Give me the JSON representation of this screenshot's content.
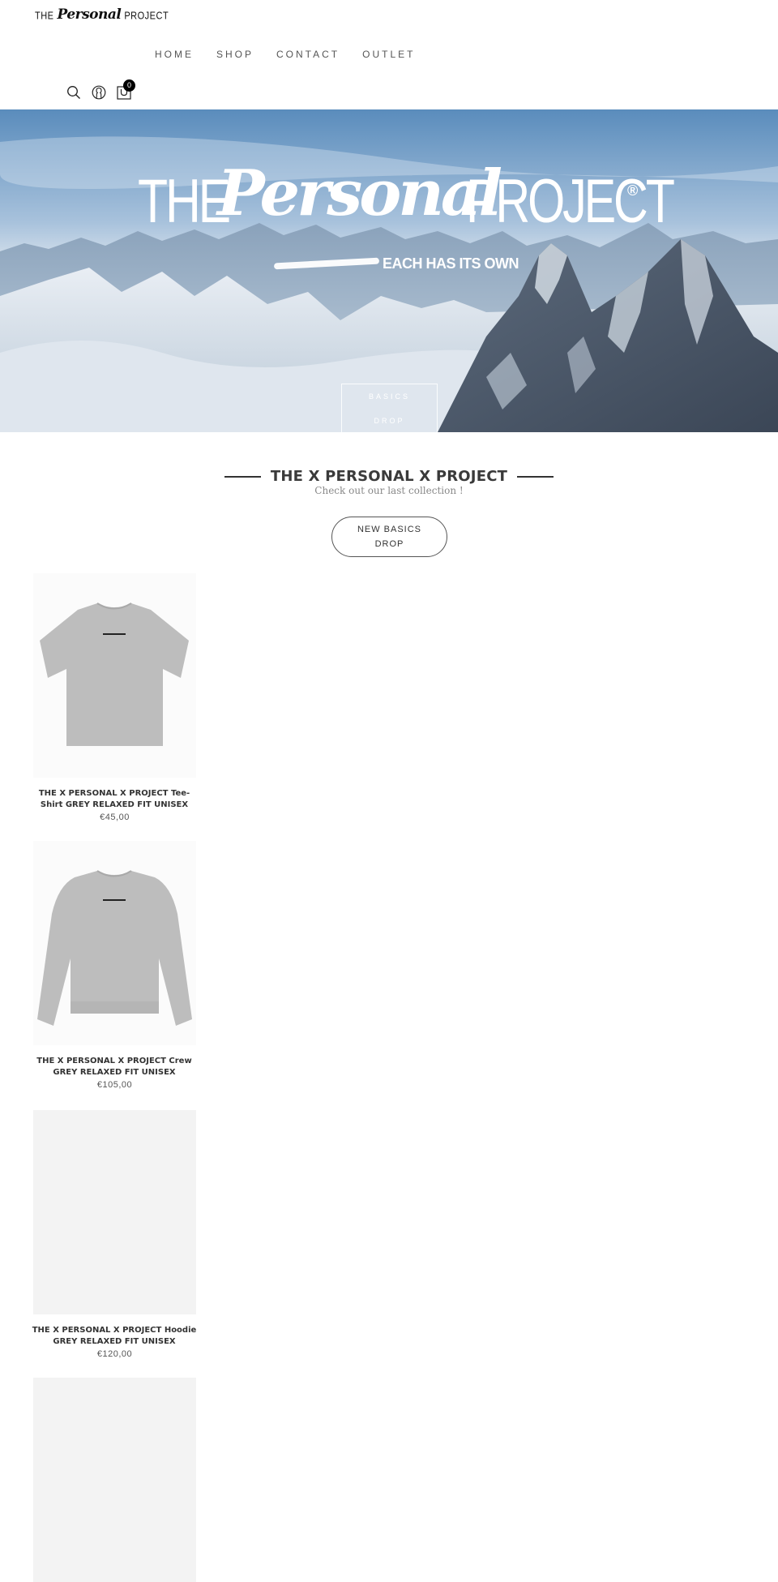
{
  "header": {
    "logo": {
      "the": "THE",
      "personal": "Personal",
      "project": "PROJECT"
    },
    "nav": [
      {
        "label": "HOME"
      },
      {
        "label": "SHOP"
      },
      {
        "label": "CONTACT"
      },
      {
        "label": "OUTLET"
      }
    ],
    "icons": [
      "search-icon",
      "account-icon",
      "cart-icon"
    ],
    "cart_count": "0"
  },
  "hero": {
    "logo": {
      "the": "THE",
      "personal": "Personal",
      "project": "PROJECT",
      "registered": "®",
      "tagline": "EACH HAS ITS OWN"
    },
    "button": {
      "line1": "BASICS",
      "line2": "DROP"
    }
  },
  "section": {
    "title": "THE X PERSONAL X PROJECT",
    "subtitle": "Check out our last collection !",
    "cta": {
      "line1": "NEW BASICS",
      "line2": "DROP"
    }
  },
  "products": [
    {
      "name": "THE X PERSONAL X PROJECT Tee-Shirt GREY RELAXED FIT UNISEX",
      "price": "€45,00",
      "image": "tshirt"
    },
    {
      "name": "THE X PERSONAL X PROJECT Crew GREY RELAXED FIT UNISEX",
      "price": "€105,00",
      "image": "crew"
    },
    {
      "name": "THE X PERSONAL X PROJECT Hoodie GREY RELAXED FIT UNISEX",
      "price": "€120,00",
      "image": "placeholder"
    },
    {
      "name": "",
      "price": "",
      "image": "placeholder"
    }
  ],
  "colors": {
    "text_dark": "#333333",
    "badge": "#000000",
    "placeholder_bg": "#f3f3f3"
  }
}
